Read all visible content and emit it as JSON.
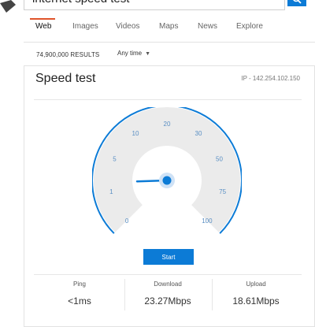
{
  "search": {
    "query": "internet speed test"
  },
  "tabs": [
    {
      "label": "Web",
      "active": true
    },
    {
      "label": "Images",
      "active": false
    },
    {
      "label": "Videos",
      "active": false
    },
    {
      "label": "Maps",
      "active": false
    },
    {
      "label": "News",
      "active": false
    },
    {
      "label": "Explore",
      "active": false
    }
  ],
  "results": {
    "count_text": "74,900,000 RESULTS",
    "time_filter": "Any time"
  },
  "speed_test": {
    "title": "Speed test",
    "ip_text": "IP - 142.254.102.150",
    "gauge": {
      "tick_labels": [
        "0",
        "1",
        "5",
        "10",
        "20",
        "30",
        "50",
        "75",
        "100"
      ],
      "needle_fraction": 0.16
    },
    "start_label": "Start",
    "stats": [
      {
        "label": "Ping",
        "value": "<1ms"
      },
      {
        "label": "Download",
        "value": "23.27Mbps"
      },
      {
        "label": "Upload",
        "value": "18.61Mbps"
      }
    ]
  },
  "colors": {
    "accent": "#0c7bd6",
    "tab_underline": "#e0542b",
    "gauge_fill": "#ebebeb",
    "tick_label": "#5a8fc4"
  }
}
